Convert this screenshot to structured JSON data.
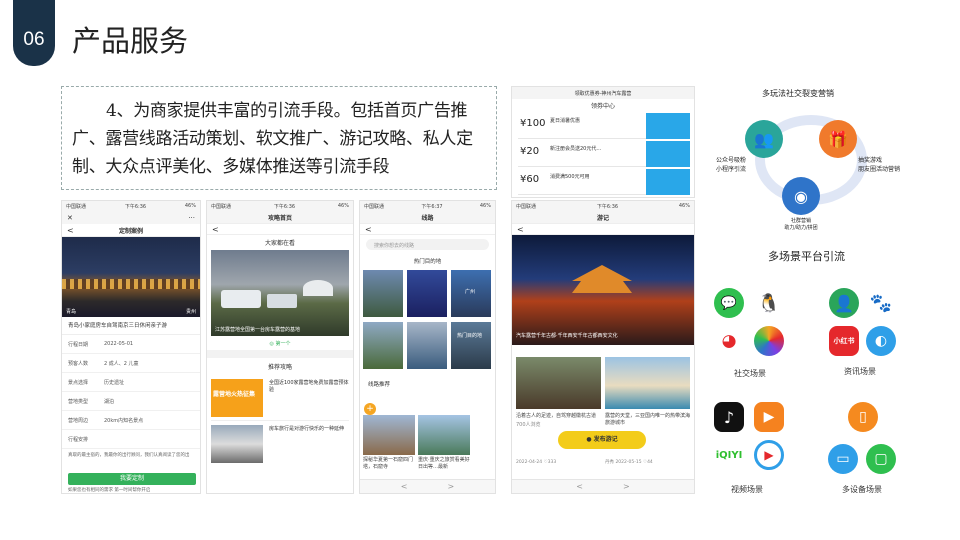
{
  "slide": {
    "number": "06",
    "title": "产品服务"
  },
  "body_text": "4、为商家提供丰富的引流手段。包括首页广告推广、露营线路活动策划、软文推广、游记攻略、私人定制、大众点评美化、多媒体推送等引流手段",
  "status": {
    "carrier": "中国联通",
    "time1": "下午6:36",
    "time2": "下午6:36",
    "time3": "下午6:37",
    "time4": "下午6:36",
    "battery": "46%"
  },
  "phone1": {
    "close": "✕",
    "more": "···",
    "back": "<",
    "title": "定制案例",
    "photo_left": "青岛",
    "photo_right": "贵州",
    "caption": "青岛小家庭房车自驾南京三日休闲亲子游",
    "rows": [
      {
        "k": "行程日期",
        "v": "2022-05-01"
      },
      {
        "k": "预客人数",
        "v": "2 成人、2 儿童"
      },
      {
        "k": "景点选择",
        "v": "历史遗址"
      },
      {
        "k": "营地类型",
        "v": "湖泊"
      },
      {
        "k": "营地周边",
        "v": "20km内知名景点"
      },
      {
        "k": "行程安排",
        "v": ""
      }
    ],
    "desc": "真取的最主宿的，我最你的出行顾问，我们认真阅读了您的出",
    "button": "我要定制",
    "footer": "如果您也有相同的需求 第一时间帮你开启"
  },
  "phone2": {
    "title": "攻略首页",
    "back": "<",
    "section1": "大家都在看",
    "photo_caption": "江苏露营地全国第一台房车露营的基地",
    "badge": "第一个",
    "section2": "推荐攻略",
    "items": [
      {
        "title": "全国近100家露营地免费加露营预体验",
        "tag": "露营地火热征集"
      },
      {
        "title": "房车旅行是对游行快乐的一种延伸",
        "tag": ""
      }
    ]
  },
  "phone3": {
    "title": "线路",
    "back": "<",
    "search_placeholder": "搜索你想去的线路",
    "section": "热门目的地",
    "dests": [
      "",
      "",
      "广州",
      "",
      "",
      "",
      "热门目的地"
    ],
    "section2": "线路推荐",
    "cards": [
      {
        "title": "探秘华夏第一石窟四门塔，石窟寺"
      },
      {
        "title": "重庆·重庆之旅赏看美好日出等…最新"
      }
    ],
    "nav_back": "<",
    "nav_fwd": ">"
  },
  "phone4": {
    "title": "领取优惠券-神州汽车露营",
    "subtitle": "领券中心",
    "coupons": [
      {
        "amt": "¥100",
        "desc": "夏日消暑优惠"
      },
      {
        "amt": "¥20",
        "desc": "新注册会员送20元代…"
      },
      {
        "amt": "¥60",
        "desc": "消费满500元可用"
      }
    ]
  },
  "phone5": {
    "title": "游记",
    "back": "<",
    "hero_caption": "汽车露营千年古都·千年西安千年古都西安文化",
    "cards": [
      {
        "title": "沿着古人的足迹，自驾穿越徽杭古道",
        "user": "700人浏览",
        "date": "2022-04-24",
        "likes": "333"
      },
      {
        "title": "露营的天堂，三亚国内唯一的热带滨海旅游城市",
        "user": "丹秀",
        "date": "2022-05-15",
        "likes": "44"
      }
    ],
    "publish": "发布游记",
    "nav_back": "<",
    "nav_fwd": ">"
  },
  "social": {
    "title": "多玩法社交裂变营销",
    "label_left": "公众号吸粉\n小程序引流",
    "label_right": "抽奖游戏\n朋友圈活动营销",
    "label_bottom": "社群营销\n助力/助力/拼团"
  },
  "platform": {
    "title": "多场景平台引流",
    "groups": [
      "社交场景",
      "资讯场景",
      "视频场景",
      "多设备场景"
    ],
    "xhs": "小红书"
  },
  "colors": {
    "badge": "#1a3248",
    "green": "#34b15b",
    "teal": "#2aa59a",
    "orange": "#f07a2c",
    "blue": "#2f74c9",
    "yellow": "#f3cc1a"
  }
}
